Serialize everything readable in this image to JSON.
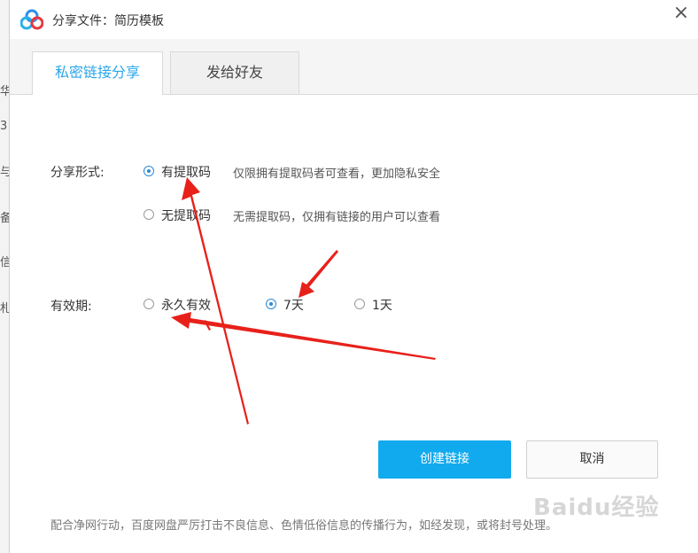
{
  "dialog": {
    "title": "分享文件：简历模板",
    "close_symbol": "×"
  },
  "tabs": [
    {
      "label": "私密链接分享",
      "active": true
    },
    {
      "label": "发给好友",
      "active": false
    }
  ],
  "share_form": {
    "label": "分享形式:",
    "options": [
      {
        "label": "有提取码",
        "description": "仅限拥有提取码者可查看，更加隐私安全",
        "checked": true
      },
      {
        "label": "无提取码",
        "description": "无需提取码，仅拥有链接的用户可以查看",
        "checked": false
      }
    ]
  },
  "validity": {
    "label": "有效期:",
    "options": [
      {
        "label": "永久有效",
        "checked": false
      },
      {
        "label": "7天",
        "checked": true
      },
      {
        "label": "1天",
        "checked": false
      }
    ]
  },
  "buttons": {
    "create": "创建链接",
    "cancel": "取消"
  },
  "notice": "配合净网行动，百度网盘严厉打击不良信息、色情低俗信息的传播行为，如经发现，或将封号处理。",
  "watermark": "Baidu经验",
  "background_chars": [
    "华",
    "3",
    "ᐧ",
    "与",
    "备",
    "信",
    "札"
  ],
  "colors": {
    "accent": "#2aa6e8",
    "primary_button": "#12aaee",
    "annotation_arrow": "#e8201a"
  },
  "icons": {
    "logo": "baidu-netdisk-logo",
    "close": "close-icon"
  }
}
